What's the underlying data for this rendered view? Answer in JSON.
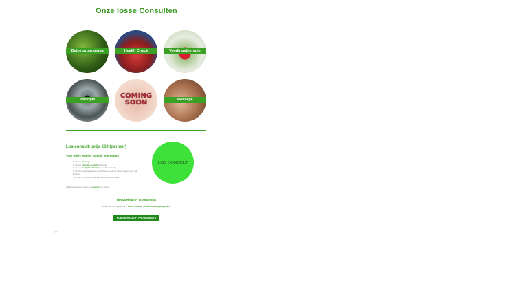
{
  "page_title": "Onze losse Consulten",
  "services": [
    {
      "label": "Detox programma"
    },
    {
      "label": "Health Check"
    },
    {
      "label": "Voedingstherapie"
    },
    {
      "label": "Iriscopie"
    },
    {
      "label": "COMING SOON"
    },
    {
      "label": "Massage"
    }
  ],
  "consult": {
    "title": "Los consult: prijs €60 (per uur)",
    "subtitle": "Voor wie is een los consult interessant",
    "list": [
      {
        "pre": "Ik wil een ",
        "strong": "massage",
        "post": ""
      },
      {
        "pre": "Ik wil een ",
        "strong": "iriscopie consult",
        "post": " ontvangen"
      },
      {
        "pre": "Ik wil een ",
        "strong": "Body Vital Check",
        "post": " (gezondheidscheck)"
      },
      {
        "pre": "Ik wil mijn voedingspatroon doorlichten en gericht advies krijgen voor mijn",
        "strong": "",
        "post": " klachten"
      },
      {
        "pre": "Ik wil een los consult naast een van de programma's",
        "strong": "",
        "post": ""
      }
    ],
    "footer_pre": "Wil je meer weten, neem dan ",
    "footer_link": "contact",
    "footer_post": " met mij op.",
    "badge": "LOS CONSULT"
  },
  "howtobehealthy": {
    "title": "How2behealthy programmas",
    "text_pre": "Bekijk hier de programma's: ",
    "link1": "Detox",
    "link2": "Voeding",
    "link3": "How2behealthy programma",
    "button": "HOW2BEHEALTHY PROGRAMMA'S"
  },
  "tiny_text": "grün",
  "colors": {
    "accent": "#3aa124",
    "button": "#1f8a1a",
    "badge": "#3ee03a"
  }
}
